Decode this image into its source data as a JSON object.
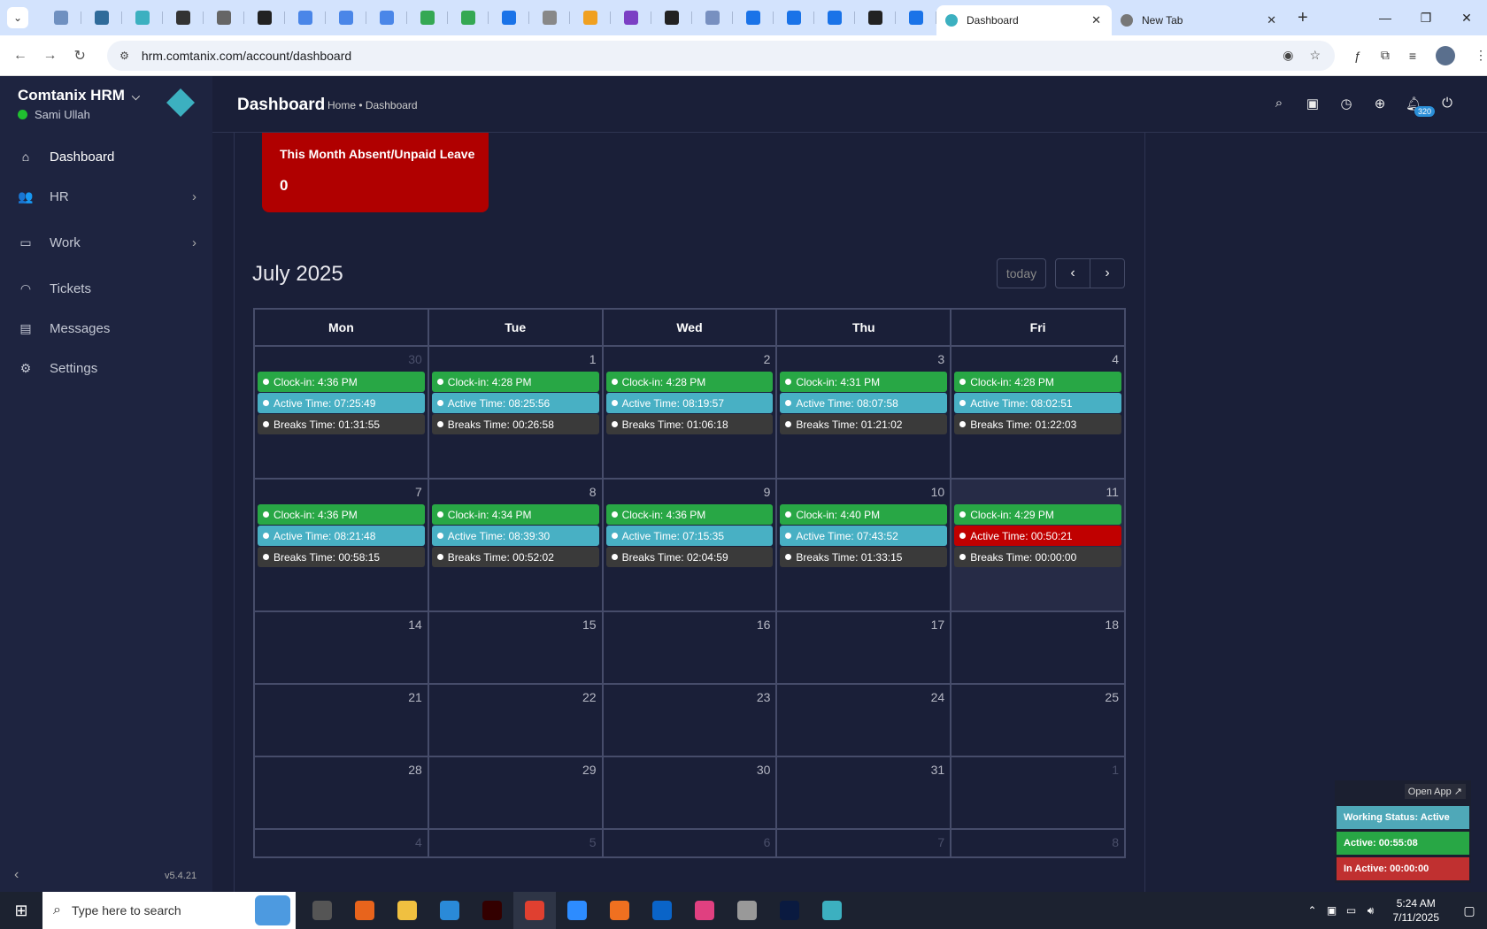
{
  "browser": {
    "tabs": [
      {
        "title": "Dashboard",
        "active": true
      },
      {
        "title": "New Tab",
        "active": false
      }
    ],
    "pinned_tab_colors": [
      "#6f90c0",
      "#2f6b9a",
      "#3cb0c0",
      "#333",
      "#666",
      "#222",
      "#4a86e8",
      "#4a86e8",
      "#4a86e8",
      "#34a853",
      "#34a853",
      "#1a73e8",
      "#888",
      "#f0a020",
      "#7b3fc4",
      "#222",
      "#7890c0",
      "#1a73e8",
      "#1a73e8",
      "#1a73e8",
      "#222",
      "#1a73e8"
    ],
    "url": "hrm.comtanix.com/account/dashboard"
  },
  "sidebar": {
    "brand": "Comtanix HRM",
    "user": "Sami Ullah",
    "items": [
      {
        "label": "Dashboard",
        "icon": "home-icon",
        "glyph": "⌂",
        "active": true,
        "has_children": false
      },
      {
        "label": "HR",
        "icon": "users-icon",
        "glyph": "👥",
        "active": false,
        "has_children": true
      },
      {
        "label": "Work",
        "icon": "briefcase-icon",
        "glyph": "▭",
        "active": false,
        "has_children": true
      },
      {
        "label": "Tickets",
        "icon": "headset-icon",
        "glyph": "◠",
        "active": false,
        "has_children": false
      },
      {
        "label": "Messages",
        "icon": "message-icon",
        "glyph": "▤",
        "active": false,
        "has_children": false
      },
      {
        "label": "Settings",
        "icon": "gear-icon",
        "glyph": "⚙",
        "active": false,
        "has_children": false
      }
    ],
    "version": "v5.4.21"
  },
  "header": {
    "title": "Dashboard",
    "breadcrumb": "Home • Dashboard",
    "notification_count": "320"
  },
  "absent_card": {
    "title": "This Month Absent/Unpaid Leave",
    "value": "0"
  },
  "calendar": {
    "title": "July 2025",
    "today_label": "today",
    "weekdays": [
      "Mon",
      "Tue",
      "Wed",
      "Thu",
      "Fri"
    ],
    "weeks": [
      {
        "days": [
          {
            "num": "30",
            "other": true,
            "events": [
              {
                "text": "Clock-in: 4:36 PM",
                "color": "green"
              },
              {
                "text": "Active Time: 07:25:49",
                "color": "cyan"
              },
              {
                "text": "Breaks Time: 01:31:55",
                "color": "dark"
              }
            ]
          },
          {
            "num": "1",
            "events": [
              {
                "text": "Clock-in: 4:28 PM",
                "color": "green"
              },
              {
                "text": "Active Time: 08:25:56",
                "color": "cyan"
              },
              {
                "text": "Breaks Time: 00:26:58",
                "color": "dark"
              }
            ]
          },
          {
            "num": "2",
            "events": [
              {
                "text": "Clock-in: 4:28 PM",
                "color": "green"
              },
              {
                "text": "Active Time: 08:19:57",
                "color": "cyan"
              },
              {
                "text": "Breaks Time: 01:06:18",
                "color": "dark"
              }
            ]
          },
          {
            "num": "3",
            "events": [
              {
                "text": "Clock-in: 4:31 PM",
                "color": "green"
              },
              {
                "text": "Active Time: 08:07:58",
                "color": "cyan"
              },
              {
                "text": "Breaks Time: 01:21:02",
                "color": "dark"
              }
            ]
          },
          {
            "num": "4",
            "events": [
              {
                "text": "Clock-in: 4:28 PM",
                "color": "green"
              },
              {
                "text": "Active Time: 08:02:51",
                "color": "cyan"
              },
              {
                "text": "Breaks Time: 01:22:03",
                "color": "dark"
              }
            ]
          }
        ]
      },
      {
        "days": [
          {
            "num": "7",
            "events": [
              {
                "text": "Clock-in: 4:36 PM",
                "color": "green"
              },
              {
                "text": "Active Time: 08:21:48",
                "color": "cyan"
              },
              {
                "text": "Breaks Time: 00:58:15",
                "color": "dark"
              }
            ]
          },
          {
            "num": "8",
            "events": [
              {
                "text": "Clock-in: 4:34 PM",
                "color": "green"
              },
              {
                "text": "Active Time: 08:39:30",
                "color": "cyan"
              },
              {
                "text": "Breaks Time: 00:52:02",
                "color": "dark"
              }
            ]
          },
          {
            "num": "9",
            "events": [
              {
                "text": "Clock-in: 4:36 PM",
                "color": "green"
              },
              {
                "text": "Active Time: 07:15:35",
                "color": "cyan"
              },
              {
                "text": "Breaks Time: 02:04:59",
                "color": "dark"
              }
            ]
          },
          {
            "num": "10",
            "events": [
              {
                "text": "Clock-in: 4:40 PM",
                "color": "green"
              },
              {
                "text": "Active Time: 07:43:52",
                "color": "cyan"
              },
              {
                "text": "Breaks Time: 01:33:15",
                "color": "dark"
              }
            ]
          },
          {
            "num": "11",
            "today": true,
            "events": [
              {
                "text": "Clock-in: 4:29 PM",
                "color": "green"
              },
              {
                "text": "Active Time: 00:50:21",
                "color": "red"
              },
              {
                "text": "Breaks Time: 00:00:00",
                "color": "dark"
              }
            ]
          }
        ]
      },
      {
        "days": [
          {
            "num": "14",
            "events": []
          },
          {
            "num": "15",
            "events": []
          },
          {
            "num": "16",
            "events": []
          },
          {
            "num": "17",
            "events": []
          },
          {
            "num": "18",
            "events": []
          }
        ]
      },
      {
        "days": [
          {
            "num": "21",
            "events": []
          },
          {
            "num": "22",
            "events": []
          },
          {
            "num": "23",
            "events": []
          },
          {
            "num": "24",
            "events": []
          },
          {
            "num": "25",
            "events": []
          }
        ]
      },
      {
        "days": [
          {
            "num": "28",
            "events": []
          },
          {
            "num": "29",
            "events": []
          },
          {
            "num": "30",
            "events": []
          },
          {
            "num": "31",
            "events": []
          },
          {
            "num": "1",
            "other": true,
            "events": []
          }
        ]
      },
      {
        "days": [
          {
            "num": "4",
            "other": true,
            "events": []
          },
          {
            "num": "5",
            "other": true,
            "events": []
          },
          {
            "num": "6",
            "other": true,
            "events": []
          },
          {
            "num": "7",
            "other": true,
            "events": []
          },
          {
            "num": "8",
            "other": true,
            "events": []
          }
        ]
      }
    ]
  },
  "widget": {
    "open_app": "Open App ↗",
    "working_status": "Working Status: Active",
    "active": "Active: 00:55:08",
    "inactive": "In Active: 00:00:00",
    "colors": {
      "status": "#4fa8b8",
      "active": "#28a745",
      "inactive": "#c03030"
    }
  },
  "taskbar": {
    "search_placeholder": "Type here to search",
    "apps": [
      {
        "name": "task-view",
        "color": "#555"
      },
      {
        "name": "firefox",
        "color": "#e8641c"
      },
      {
        "name": "file-explorer",
        "color": "#f0c040"
      },
      {
        "name": "vscode",
        "color": "#2a8ad8"
      },
      {
        "name": "illustrator",
        "color": "#330000"
      },
      {
        "name": "chrome",
        "color": "#e04030",
        "on": true
      },
      {
        "name": "zoom",
        "color": "#2d8cff"
      },
      {
        "name": "xampp",
        "color": "#f07020"
      },
      {
        "name": "outlook",
        "color": "#0a64c8"
      },
      {
        "name": "creative-cloud",
        "color": "#e04080"
      },
      {
        "name": "pen-tool",
        "color": "#999"
      },
      {
        "name": "photoshop",
        "color": "#0a1a40"
      },
      {
        "name": "comtanix",
        "color": "#3cb0c0"
      }
    ],
    "time": "5:24 AM",
    "date": "7/11/2025"
  }
}
